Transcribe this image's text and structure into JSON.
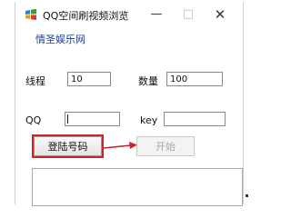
{
  "window": {
    "title": "QQ空间刷视频浏览",
    "controls": {
      "minimize": "—",
      "maximize": "□",
      "close": "✕"
    }
  },
  "link": {
    "text": "情圣娱乐网"
  },
  "form": {
    "threads_label": "线程",
    "threads_value": "10",
    "count_label": "数量",
    "count_value": "100",
    "qq_label": "QQ",
    "qq_value": "",
    "key_label": "key",
    "key_value": ""
  },
  "buttons": {
    "login": "登陆号码",
    "start": "开始"
  },
  "colors": {
    "highlight": "#c7262b",
    "link": "#1d3f8a"
  },
  "icons": {
    "app": "windows-logo-icon",
    "arrow": "right-arrow-icon"
  },
  "log": {
    "text": ""
  }
}
